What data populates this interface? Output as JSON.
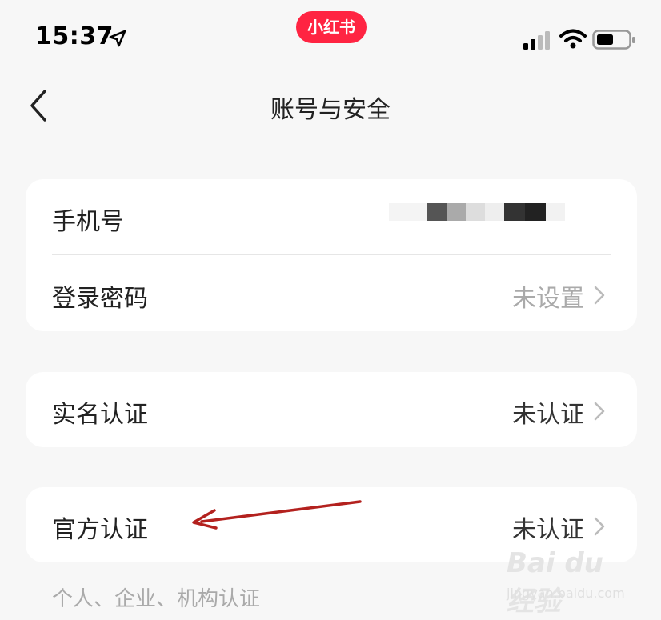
{
  "status_bar": {
    "time": "15:37",
    "app_badge": "小红书"
  },
  "nav": {
    "title": "账号与安全"
  },
  "rows": {
    "phone": {
      "label": "手机号",
      "value": ""
    },
    "password": {
      "label": "登录密码",
      "value": "未设置"
    },
    "realname": {
      "label": "实名认证",
      "value": "未认证"
    },
    "official": {
      "label": "官方认证",
      "value": "未认证"
    }
  },
  "hint": "个人、企业、机构认证",
  "watermark": {
    "main": "Bai du 经验",
    "sub": "jingyan.baidu.com"
  },
  "colors": {
    "brand": "#ff2442",
    "annotation_arrow": "#b3211e",
    "value_muted": "#aaaaaa",
    "value_dark": "#333333"
  }
}
